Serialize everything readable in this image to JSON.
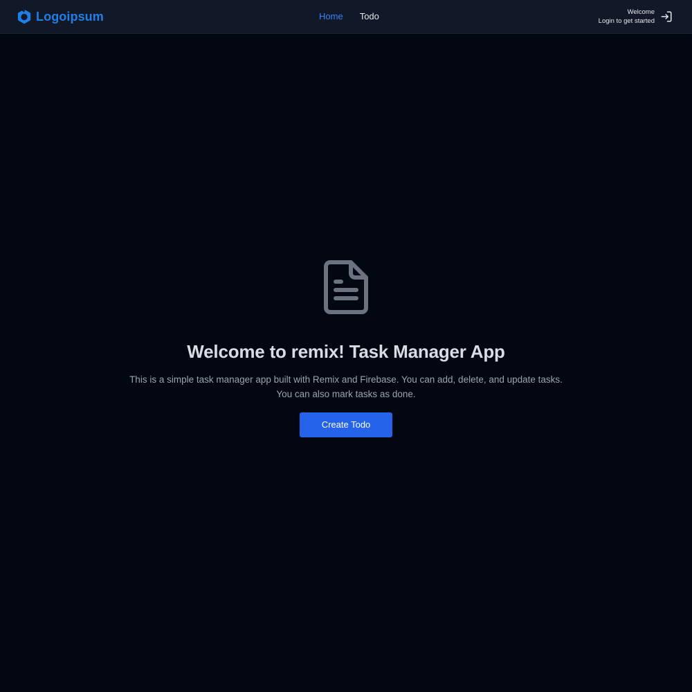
{
  "brand": {
    "name": "Logoipsum",
    "logo_icon": "logoipsum-mark-icon",
    "color": "#1f7fe6"
  },
  "nav": {
    "items": [
      {
        "label": "Home",
        "active": true
      },
      {
        "label": "Todo",
        "active": false
      }
    ],
    "active_color": "#3b82f6"
  },
  "user": {
    "greeting": "Welcome",
    "subtitle": "Login to get started",
    "login_icon": "login-icon"
  },
  "hero": {
    "icon": "document-icon",
    "title": "Welcome to remix! Task Manager App",
    "description_line1": "This is a simple task manager app built with Remix and Firebase. You can add, delete, and update tasks.",
    "description_line2": "You can also mark tasks as done.",
    "cta_label": "Create Todo"
  },
  "colors": {
    "background": "#030712",
    "navbar": "#111827",
    "primary_button": "#2563eb"
  }
}
